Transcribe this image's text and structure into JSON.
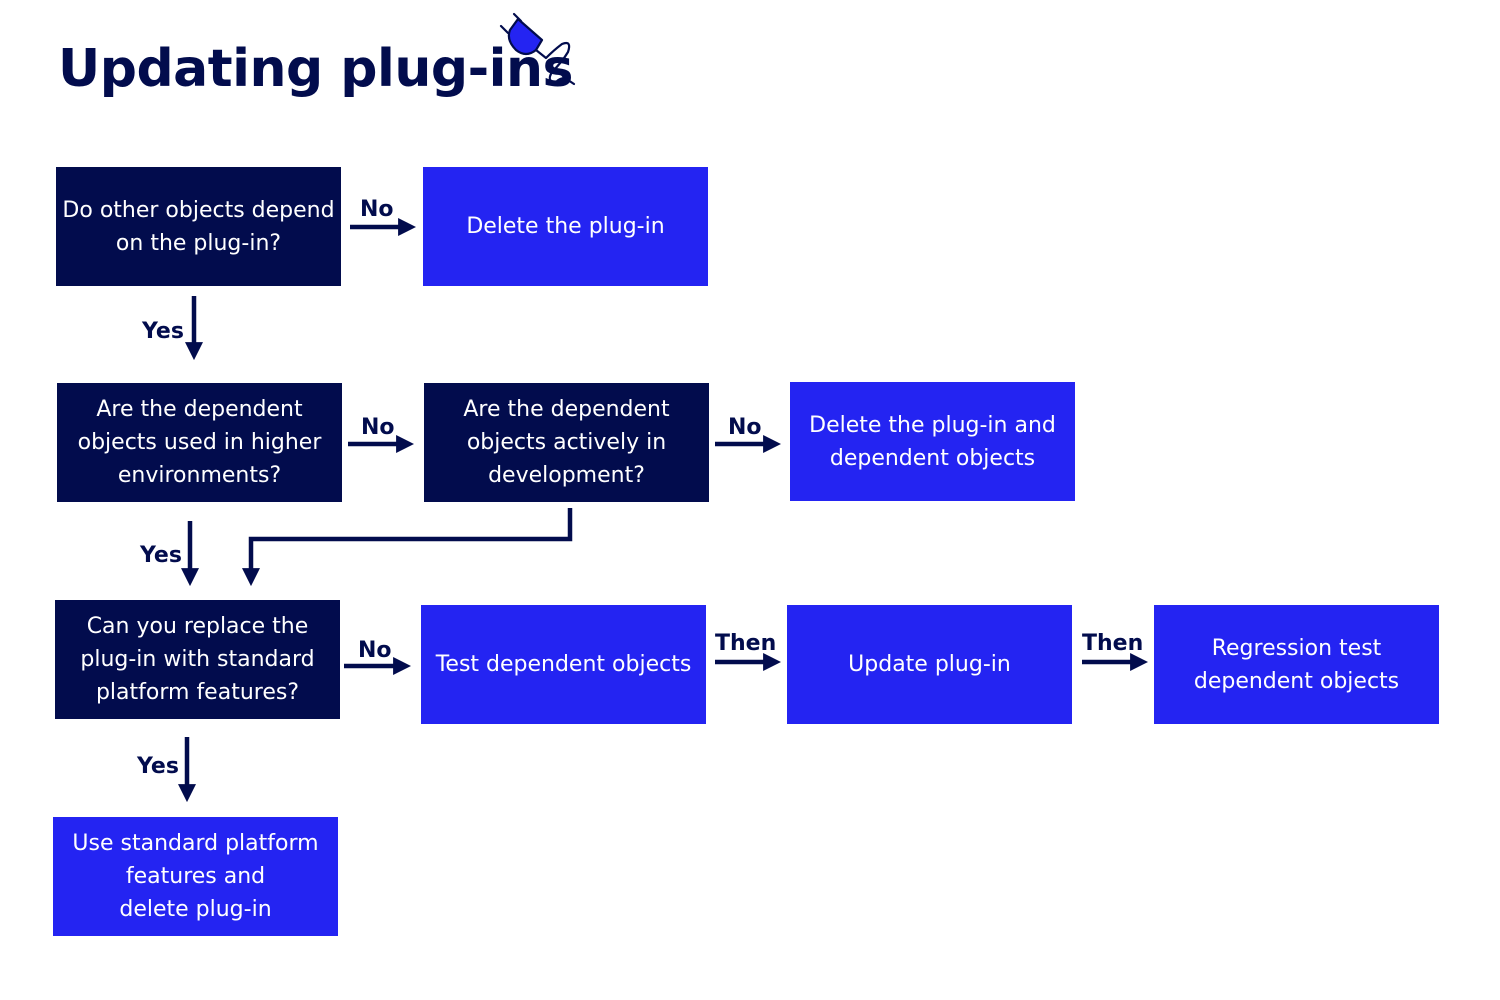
{
  "title": "Updating plug-ins",
  "title_icon": "plug-icon",
  "colors": {
    "question": "#020c4d",
    "action": "#2424f2",
    "connector": "#020c4d",
    "text_on_box": "#ffffff"
  },
  "nodes": {
    "q1": "Do other objects depend\non the plug-in?",
    "a1": "Delete the plug-in",
    "q2": "Are the dependent\nobjects used in higher\nenvironments?",
    "q3": "Are the dependent\nobjects actively in\ndevelopment?",
    "a2": "Delete the plug-in and\ndependent objects",
    "q4": "Can you replace the\nplug-in with standard\nplatform features?",
    "a3": "Test dependent objects",
    "a4": "Update plug-in",
    "a5": "Regression test\ndependent objects",
    "a6": "Use standard platform\nfeatures and\ndelete plug-in"
  },
  "edges": [
    {
      "from": "q1",
      "to": "a1",
      "label": "No"
    },
    {
      "from": "q1",
      "to": "q2",
      "label": "Yes"
    },
    {
      "from": "q2",
      "to": "q3",
      "label": "No"
    },
    {
      "from": "q3",
      "to": "a2",
      "label": "No"
    },
    {
      "from": "q2",
      "to": "q4",
      "label": "Yes"
    },
    {
      "from": "q3",
      "to": "q4",
      "label": ""
    },
    {
      "from": "q4",
      "to": "a3",
      "label": "No"
    },
    {
      "from": "a3",
      "to": "a4",
      "label": "Then"
    },
    {
      "from": "a4",
      "to": "a5",
      "label": "Then"
    },
    {
      "from": "q4",
      "to": "a6",
      "label": "Yes"
    }
  ]
}
